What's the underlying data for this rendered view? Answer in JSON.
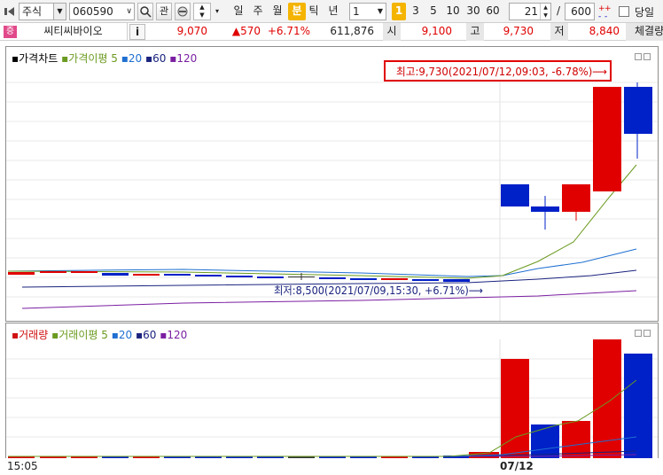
{
  "toolbar": {
    "market": "주식",
    "code": "060590",
    "gwan": "관",
    "periods": [
      "일",
      "주",
      "월",
      "분",
      "틱",
      "년"
    ],
    "active_period": "분",
    "interval": "1",
    "intervals": [
      "1",
      "3",
      "5",
      "10",
      "30",
      "60"
    ],
    "active_interval": "1",
    "count": "21",
    "slash": "/",
    "total": "600",
    "today_label": "당일"
  },
  "info": {
    "badge": "증",
    "name": "씨티씨바이오",
    "i_label": "i",
    "price": "9,070",
    "change": "▲570",
    "rate": "+6.71%",
    "volume": "611,876",
    "open_label": "시",
    "open": "9,100",
    "high_label": "고",
    "high": "9,730",
    "low_label": "저",
    "low": "8,840",
    "exec_label": "체결량"
  },
  "price_panel": {
    "legend": [
      {
        "text": "가격차트",
        "color": "#000000"
      },
      {
        "text": "가격이평 5",
        "color": "#6a9a1f"
      },
      {
        "text": "20",
        "color": "#1f6fd1"
      },
      {
        "text": "60",
        "color": "#1a237e"
      },
      {
        "text": "120",
        "color": "#7b1fa2"
      }
    ],
    "high_annotation": "최고:9,730(2021/07/12,09:03, -6.78%)⟶",
    "low_annotation": "최저:8,500(2021/07/09,15:30, +6.71%)⟶"
  },
  "volume_panel": {
    "legend": [
      {
        "text": "거래량",
        "color": "#d01010"
      },
      {
        "text": "거래이평 5",
        "color": "#6a9a1f"
      },
      {
        "text": "20",
        "color": "#1f6fd1"
      },
      {
        "text": "60",
        "color": "#1a237e"
      },
      {
        "text": "120",
        "color": "#7b1fa2"
      }
    ]
  },
  "time_axis": {
    "left": "15:05",
    "date": "07/12"
  },
  "colors": {
    "up": "#e00000",
    "down": "#0020c8",
    "ma5": "#6a9a1f",
    "ma20": "#1f6fd1",
    "ma60": "#1a237e",
    "ma120": "#7b1fa2",
    "highlight": "#f4b400"
  }
}
